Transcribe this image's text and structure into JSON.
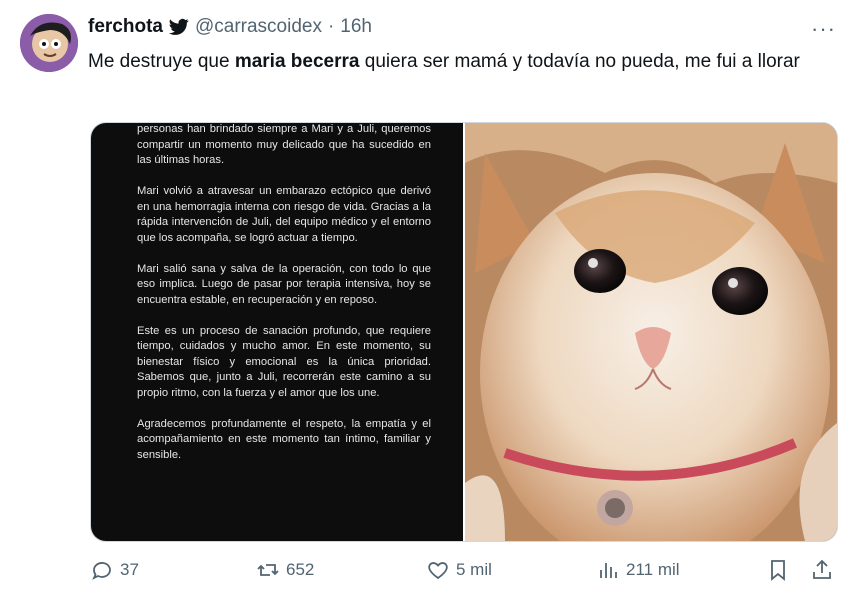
{
  "tweet": {
    "display_name": "ferchota",
    "handle": "@carrascoidex",
    "separator": "·",
    "time": "16h",
    "more_label": "···",
    "text_before": "Me destruye que ",
    "text_bold": "maria becerra",
    "text_after": " quiera ser mamá y todavía no pueda, me fui a llorar"
  },
  "statement": {
    "paragraphs": [
      "personas han brindado siempre a Mari y a Juli, queremos compartir un momento muy delicado que ha sucedido  en las últimas horas.",
      "Mari volvió a atravesar un embarazo ectópico que derivó en una hemorragia interna con riesgo de vida. Gracias a la rápida intervención de Juli, del equipo médico y el entorno que los acompaña, se logró actuar a tiempo.",
      "Mari salió sana y salva de la operación, con todo lo que eso implica. Luego de pasar por terapia intensiva, hoy se encuentra estable, en recuperación y en reposo.",
      "Este es un proceso de sanación profundo, que requiere tiempo, cuidados y mucho amor. En este momento, su bienestar físico y emocional es la única prioridad. Sabemos que, junto a Juli, recorrerán este camino a su propio ritmo, con la fuerza y el amor que los une.",
      "Agradecemos profundamente el respeto, la empatía y el acompañamiento en este momento tan íntimo, familiar y sensible."
    ]
  },
  "actions": {
    "replies": "37",
    "reposts": "652",
    "likes": "5 mil",
    "views": "211 mil"
  },
  "icons": {
    "verified": "bird-icon",
    "reply": "reply-icon",
    "repost": "repost-icon",
    "like": "heart-icon",
    "views": "views-icon",
    "bookmark": "bookmark-icon",
    "share": "share-icon"
  },
  "colors": {
    "text": "#0f1419",
    "muted": "#536471",
    "bird": "#0f1419"
  }
}
